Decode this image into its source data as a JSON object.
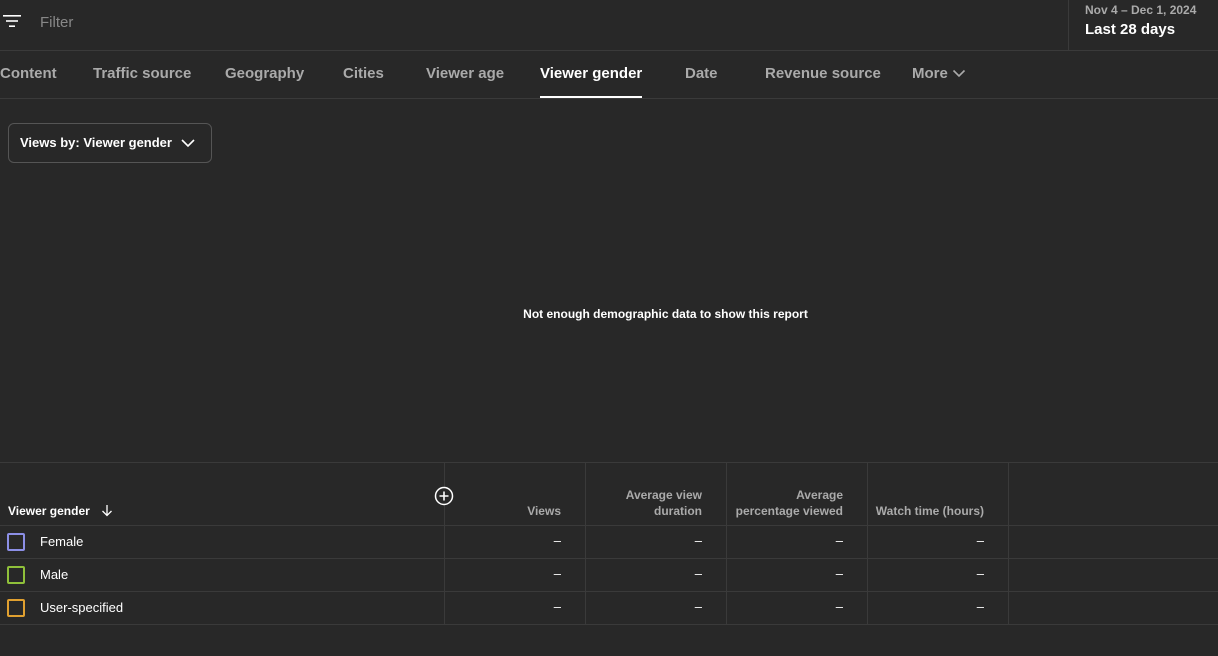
{
  "filter": {
    "placeholder": "Filter",
    "icon": "filter-icon"
  },
  "date_range": {
    "range": "Nov 4 – Dec 1, 2024",
    "label": "Last 28 days"
  },
  "tabs": [
    {
      "label": "Content"
    },
    {
      "label": "Traffic source"
    },
    {
      "label": "Geography"
    },
    {
      "label": "Cities"
    },
    {
      "label": "Viewer age"
    },
    {
      "label": "Viewer gender",
      "active": true
    },
    {
      "label": "Date"
    },
    {
      "label": "Revenue source"
    },
    {
      "label": "More",
      "icon": "chevron-down-icon"
    }
  ],
  "views_selector": {
    "label": "Views by: Viewer gender"
  },
  "empty_message": "Not enough demographic data to show this report",
  "table": {
    "first_header": "Viewer gender",
    "columns": [
      "Views",
      "Average view duration",
      "Average percentage viewed",
      "Watch time (hours)"
    ],
    "rows": [
      {
        "label": "Female",
        "color": "#8c8fe6",
        "values": [
          "–",
          "–",
          "–",
          "–"
        ]
      },
      {
        "label": "Male",
        "color": "#8fc03a",
        "values": [
          "–",
          "–",
          "–",
          "–"
        ]
      },
      {
        "label": "User-specified",
        "color": "#e0a030",
        "values": [
          "–",
          "–",
          "–",
          "–"
        ]
      }
    ]
  }
}
